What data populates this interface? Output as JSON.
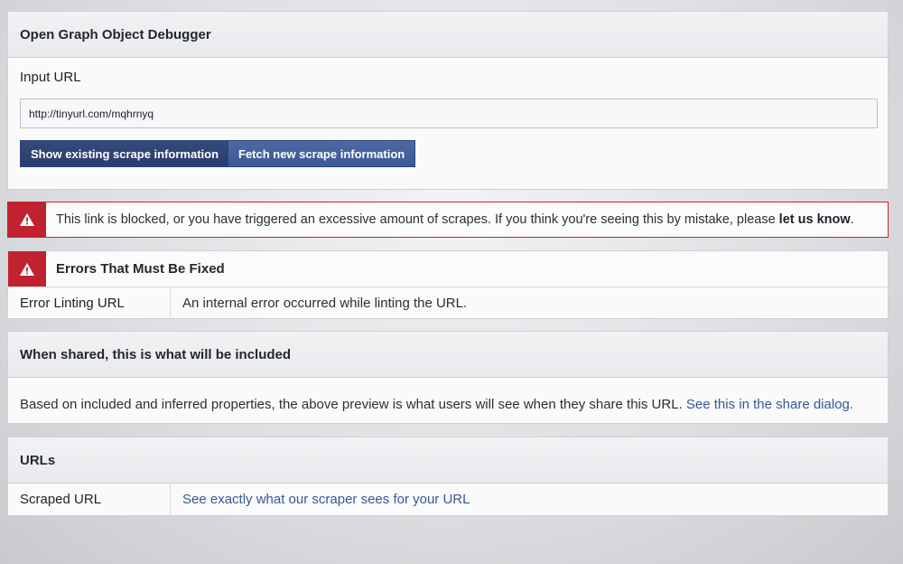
{
  "debugger": {
    "title": "Open Graph Object Debugger",
    "input_label": "Input URL",
    "input_value": "http://tinyurl.com/mqhrnyq",
    "btn_show": "Show existing scrape information",
    "btn_fetch": "Fetch new scrape information"
  },
  "alert": {
    "text": "This link is blocked, or you have triggered an excessive amount of scrapes. If you think you're seeing this by mistake, please ",
    "link": "let us know",
    "suffix": "."
  },
  "errors": {
    "title": "Errors That Must Be Fixed",
    "row_label": "Error Linting URL",
    "row_value": "An internal error occurred while linting the URL."
  },
  "shared": {
    "title": "When shared, this is what will be included",
    "body": "Based on included and inferred properties, the above preview is what users will see when they share this URL. ",
    "link": "See this in the share dialog."
  },
  "urls": {
    "title": "URLs",
    "row_label": "Scraped URL",
    "row_link": "See exactly what our scraper sees for your URL"
  },
  "colors": {
    "brand_blue": "#3b5998",
    "alert_red": "#c0232f",
    "link_blue": "#365899"
  },
  "icons": [
    "warning-icon"
  ]
}
